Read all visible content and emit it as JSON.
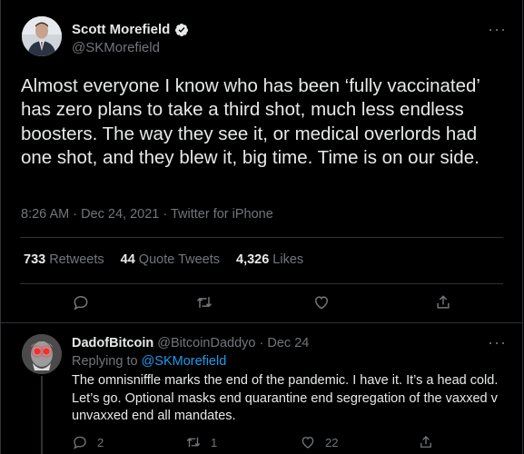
{
  "tweet": {
    "author_name": "Scott Morefield",
    "author_handle": "@SKMorefield",
    "text": "Almost everyone I know who has been ‘fully vaccinated’ has zero plans to take a third shot, much less endless boosters. The way they see it, or medical overlords had one shot, and they blew it, big time. Time is on our side.",
    "timestamp": "8:26 AM · Dec 24, 2021 · Twitter for iPhone",
    "stats": [
      {
        "count": "733",
        "label": "Retweets"
      },
      {
        "count": "44",
        "label": "Quote Tweets"
      },
      {
        "count": "4,326",
        "label": "Likes"
      }
    ],
    "more_icon": "···"
  },
  "reply": {
    "author_name": "DadofBitcoin",
    "author_handle": "@BitcoinDaddyo",
    "separator": " · ",
    "date": "Dec 24",
    "replying_prefix": "Replying to ",
    "replying_handle": "@SKMorefield",
    "text": "The omnisniffle marks the end of the pandemic. I have it. It’s a head cold. Let’s go. Optional masks end quarantine end segregation of the vaxxed v unvaxxed end all mandates.",
    "reply_count": "2",
    "retweet_count": "1",
    "like_count": "22",
    "more_icon": "···"
  },
  "colors": {
    "accent": "#1d9bf0",
    "muted": "#71767b",
    "text": "#e7e9ea",
    "divider": "#2f3336"
  }
}
